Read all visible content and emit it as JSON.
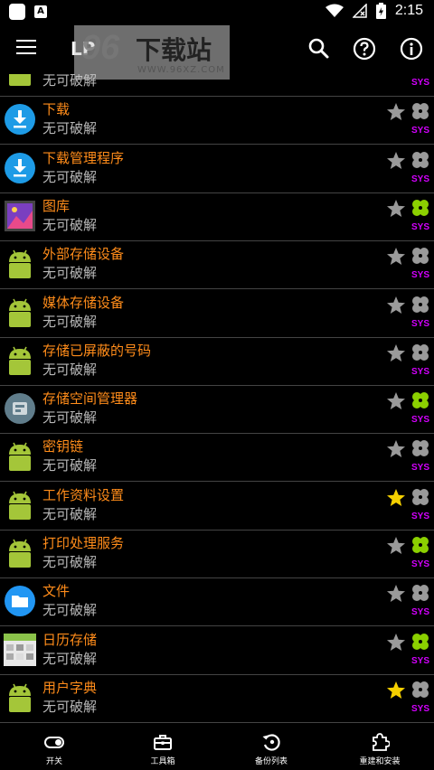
{
  "status_bar": {
    "time": "2:15",
    "notif_letter": "A"
  },
  "app_bar": {
    "title": "LP"
  },
  "watermark": {
    "number": "96",
    "text": "下载站",
    "url": "WWW.96XZ.COM"
  },
  "rows": [
    {
      "name": "",
      "status": "无可破解",
      "icon": "android",
      "starred": true,
      "clover_green": false,
      "sys": "SYS"
    },
    {
      "name": "下载",
      "status": "无可破解",
      "icon": "download",
      "starred": false,
      "clover_green": false,
      "sys": "SYS"
    },
    {
      "name": "下载管理程序",
      "status": "无可破解",
      "icon": "download",
      "starred": false,
      "clover_green": false,
      "sys": "SYS"
    },
    {
      "name": "图库",
      "status": "无可破解",
      "icon": "gallery",
      "starred": false,
      "clover_green": true,
      "sys": "SYS"
    },
    {
      "name": "外部存储设备",
      "status": "无可破解",
      "icon": "android",
      "starred": false,
      "clover_green": false,
      "sys": "SYS"
    },
    {
      "name": "媒体存储设备",
      "status": "无可破解",
      "icon": "android",
      "starred": false,
      "clover_green": false,
      "sys": "SYS"
    },
    {
      "name": "存储已屏蔽的号码",
      "status": "无可破解",
      "icon": "android",
      "starred": false,
      "clover_green": false,
      "sys": "SYS"
    },
    {
      "name": "存储空间管理器",
      "status": "无可破解",
      "icon": "storage",
      "starred": false,
      "clover_green": true,
      "sys": "SYS"
    },
    {
      "name": "密钥链",
      "status": "无可破解",
      "icon": "android",
      "starred": false,
      "clover_green": false,
      "sys": "SYS"
    },
    {
      "name": "工作资料设置",
      "status": "无可破解",
      "icon": "android",
      "starred": true,
      "clover_green": false,
      "sys": "SYS"
    },
    {
      "name": "打印处理服务",
      "status": "无可破解",
      "icon": "android",
      "starred": false,
      "clover_green": true,
      "sys": "SYS"
    },
    {
      "name": "文件",
      "status": "无可破解",
      "icon": "files",
      "starred": false,
      "clover_green": false,
      "sys": "SYS"
    },
    {
      "name": "日历存储",
      "status": "无可破解",
      "icon": "calendar",
      "starred": false,
      "clover_green": true,
      "sys": "SYS"
    },
    {
      "name": "用户字典",
      "status": "无可破解",
      "icon": "android",
      "starred": true,
      "clover_green": false,
      "sys": "SYS"
    }
  ],
  "bottom_nav": [
    {
      "label": "开关",
      "icon": "toggle-icon"
    },
    {
      "label": "工具箱",
      "icon": "toolbox-icon"
    },
    {
      "label": "备份列表",
      "icon": "backup-icon"
    },
    {
      "label": "重建和安装",
      "icon": "puzzle-icon"
    }
  ],
  "colors": {
    "app_name": "#ff8c1a",
    "status_text": "#b8b8b8",
    "sys_badge": "#d400ff",
    "star_active": "#f5d000",
    "star_inactive": "#9a9a9a",
    "clover_active": "#8bd000",
    "clover_inactive": "#9a9a9a",
    "android_green": "#a4c639"
  }
}
